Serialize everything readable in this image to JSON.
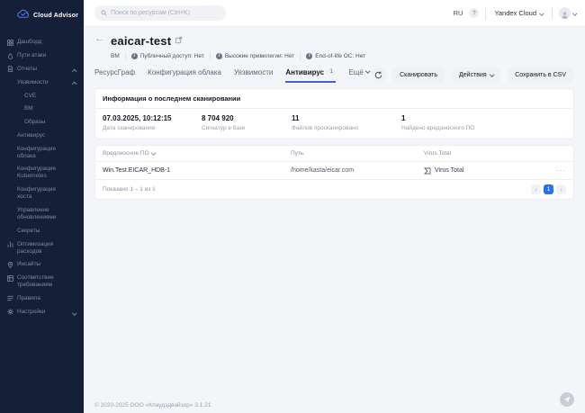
{
  "app": {
    "logo": "Cloud Advisor",
    "footer": "© 2020-2025 ООО «Клаудэдвайзор» 3.1.21",
    "colors": {
      "accent": "#2f6fe8",
      "sidebar_bg": "#161f38"
    }
  },
  "header": {
    "search_placeholder": "Поиск по ресурсам (Ctrl+K)",
    "language": "RU",
    "help_label": "?",
    "org": "Yandex Cloud"
  },
  "sidebar": {
    "items": [
      {
        "id": "dashboard",
        "icon": "dashboard-icon",
        "label": "Дашборд",
        "level": 0
      },
      {
        "id": "attack-paths",
        "icon": "attack-paths-icon",
        "label": "Пути атаки",
        "level": 0
      },
      {
        "id": "reports",
        "icon": "reports-icon",
        "label": "Отчеты",
        "level": 0,
        "chevron": "up"
      },
      {
        "id": "vulnerabilities",
        "label": "Уязвимости",
        "level": 1,
        "chevron": "up"
      },
      {
        "id": "cve",
        "label": "CVE",
        "level": 2
      },
      {
        "id": "vm",
        "label": "ВМ",
        "level": 2
      },
      {
        "id": "images",
        "label": "Образы",
        "level": 2
      },
      {
        "id": "antivirus",
        "label": "Антивирус",
        "level": 1
      },
      {
        "id": "cloud-config",
        "label": "Конфигурация облака",
        "level": 1
      },
      {
        "id": "kubernetes-config",
        "label": "Конфигурация Kubernetes",
        "level": 1
      },
      {
        "id": "host-config",
        "label": "Конфигурация хоста",
        "level": 1
      },
      {
        "id": "update-management",
        "label": "Управление обновлениями",
        "level": 1
      },
      {
        "id": "secrets",
        "label": "Секреты",
        "level": 1
      },
      {
        "id": "cost-optimization",
        "icon": "costs-icon",
        "label": "Оптимизация расходов",
        "level": 0
      },
      {
        "id": "insights",
        "icon": "insights-icon",
        "label": "Инсайты",
        "level": 0
      },
      {
        "id": "compliance",
        "icon": "compliance-icon",
        "label": "Соответствие требованиям",
        "level": 0
      },
      {
        "id": "rules",
        "icon": "rules-icon",
        "label": "Правила",
        "level": 0
      },
      {
        "id": "settings",
        "icon": "settings-icon",
        "label": "Настройки",
        "level": 0,
        "chevron": "down"
      }
    ]
  },
  "page": {
    "title": "eaicar-test",
    "resource_type": "ВМ",
    "meta_badges": [
      {
        "label": "Публичный доступ: Нет"
      },
      {
        "label": "Высокие привилегии: Нет"
      },
      {
        "label": "End-of-life ОС: Нет"
      }
    ],
    "tabs": [
      {
        "id": "resource-graph",
        "label": "РесурсГраф"
      },
      {
        "id": "cloud-config",
        "label": "Конфигурация облака"
      },
      {
        "id": "vulnerabilities",
        "label": "Уязвимости"
      },
      {
        "id": "antivirus",
        "label": "Антивирус",
        "badge": "1",
        "active": true
      },
      {
        "id": "more",
        "label": "Ещё",
        "chevron": true
      }
    ],
    "actions": {
      "scan": "Сканировать",
      "menu": "Действия",
      "save_csv": "Сохранить в CSV"
    }
  },
  "scan_info": {
    "title": "Информация о последнем сканировании",
    "stats": [
      {
        "value": "07.03.2025, 10:12:15",
        "label": "Дата сканирования"
      },
      {
        "value": "8 704 920",
        "label": "Сигнатур в базе"
      },
      {
        "value": "11",
        "label": "Файлов просканировано"
      },
      {
        "value": "1",
        "label": "Найдено вредоносного ПО"
      }
    ]
  },
  "table": {
    "columns": {
      "malware": "Вредоносное ПО",
      "path": "Путь",
      "virustotal": "Virus Total"
    },
    "rows": [
      {
        "malware": "Win.Test.EICAR_HDB-1",
        "path": "/home/kasta/eicar.com",
        "virustotal": "Virus Total"
      }
    ],
    "footer": {
      "shown": "Показано 1 – 1 из 1",
      "page": "1"
    }
  }
}
